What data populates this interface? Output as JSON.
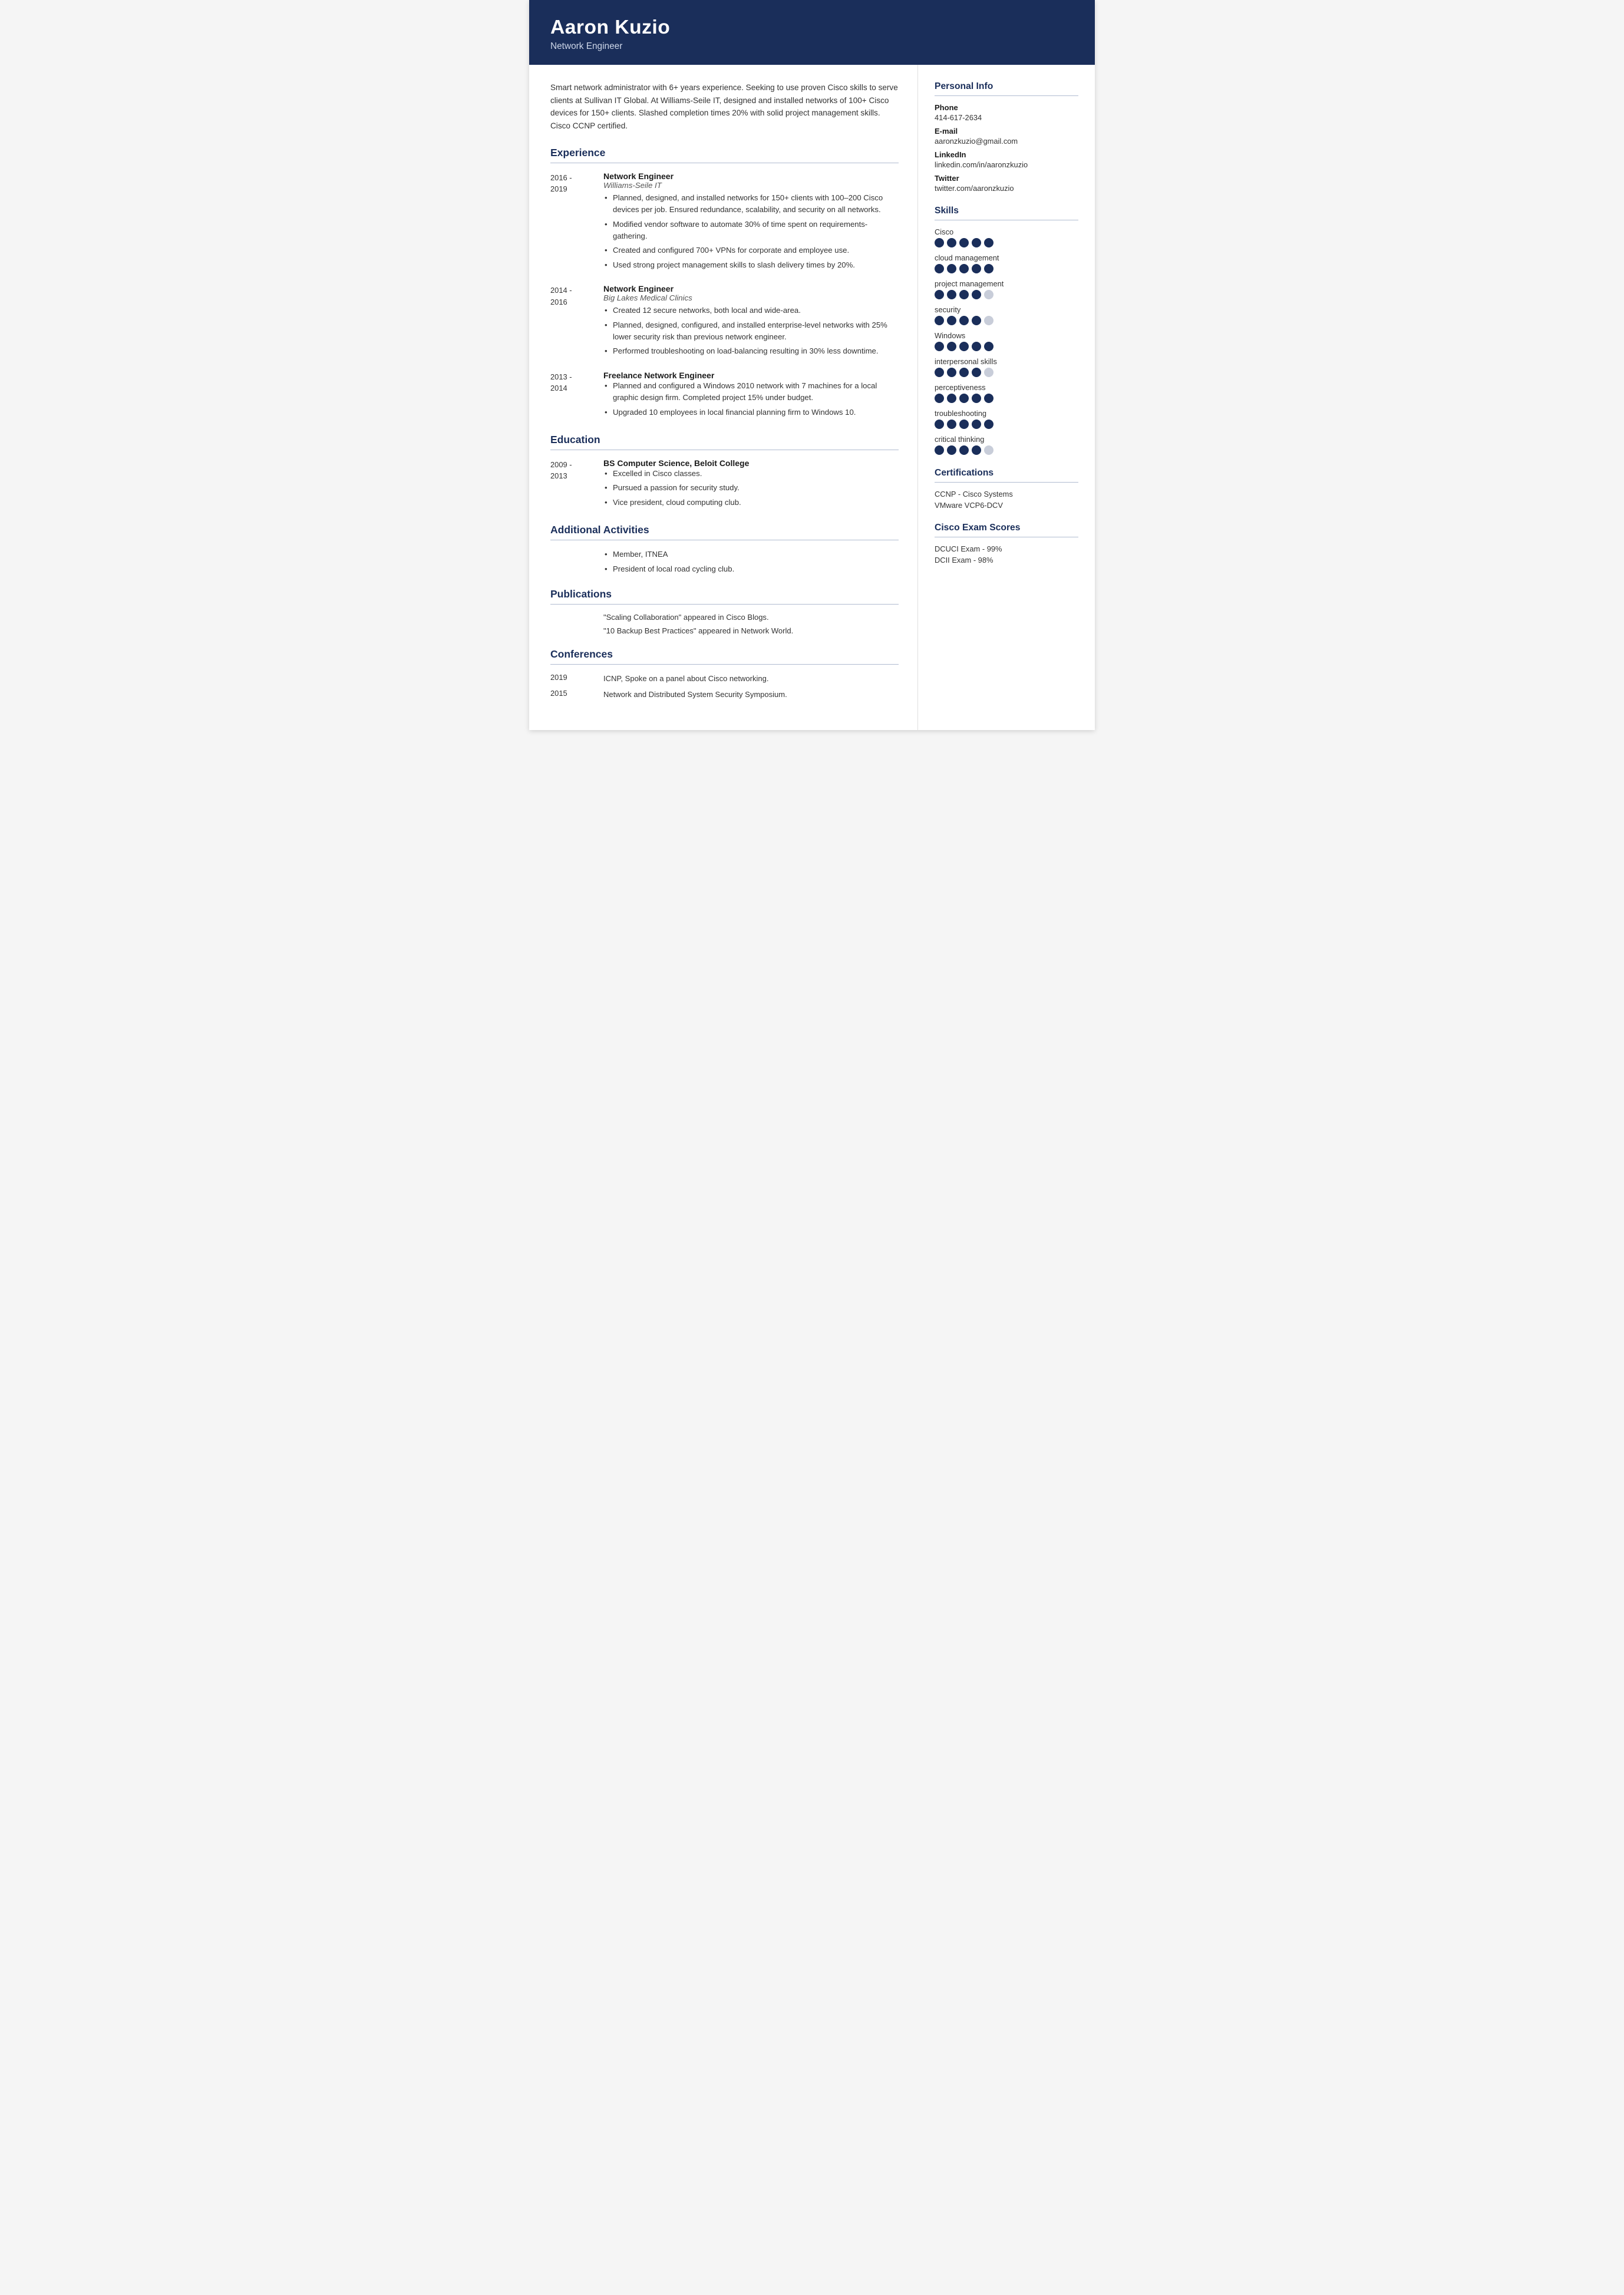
{
  "header": {
    "name": "Aaron Kuzio",
    "title": "Network Engineer"
  },
  "summary": "Smart network administrator with 6+ years experience. Seeking to use proven Cisco skills to serve clients at Sullivan IT Global. At Williams-Seile IT, designed and installed networks of 100+ Cisco devices for 150+ clients. Slashed completion times 20% with solid project management skills. Cisco CCNP certified.",
  "sections": {
    "experience_label": "Experience",
    "education_label": "Education",
    "additional_label": "Additional Activities",
    "publications_label": "Publications",
    "conferences_label": "Conferences"
  },
  "experience": [
    {
      "date_start": "2016 -",
      "date_end": "2019",
      "title": "Network Engineer",
      "org": "Williams-Seile IT",
      "bullets": [
        "Planned, designed, and installed networks for 150+ clients with 100–200 Cisco devices per job. Ensured redundance, scalability, and security on all networks.",
        "Modified vendor software to automate 30% of time spent on requirements-gathering.",
        "Created and configured 700+ VPNs for corporate and employee use.",
        "Used strong project management skills to slash delivery times by 20%."
      ]
    },
    {
      "date_start": "2014 -",
      "date_end": "2016",
      "title": "Network Engineer",
      "org": "Big Lakes Medical Clinics",
      "bullets": [
        "Created 12 secure networks, both local and wide-area.",
        "Planned, designed, configured, and installed enterprise-level networks with 25% lower security risk than previous network engineer.",
        "Performed troubleshooting on load-balancing resulting in 30% less downtime."
      ]
    },
    {
      "date_start": "2013 -",
      "date_end": "2014",
      "title": "Freelance Network Engineer",
      "org": "",
      "bullets": [
        "Planned and configured a Windows 2010 network with 7 machines for a local graphic design firm. Completed project 15% under budget.",
        "Upgraded 10 employees in local financial planning firm to Windows 10."
      ]
    }
  ],
  "education": [
    {
      "date_start": "2009 -",
      "date_end": "2013",
      "title": "BS Computer Science, Beloit College",
      "org": "",
      "bullets": [
        "Excelled in Cisco classes.",
        "Pursued a passion for security study.",
        "Vice president, cloud computing club."
      ]
    }
  ],
  "additional": {
    "bullets": [
      "Member, ITNEA",
      "President of local road cycling club."
    ]
  },
  "publications": {
    "items": [
      "\"Scaling Collaboration\" appeared in Cisco Blogs.",
      "\"10 Backup Best Practices\" appeared in Network World."
    ]
  },
  "conferences": [
    {
      "year": "2019",
      "desc": "ICNP, Spoke on a panel about Cisco networking."
    },
    {
      "year": "2015",
      "desc": "Network and Distributed System Security Symposium."
    }
  ],
  "personal_info": {
    "section_label": "Personal Info",
    "phone_label": "Phone",
    "phone": "414-617-2634",
    "email_label": "E-mail",
    "email": "aaronzkuzio@gmail.com",
    "linkedin_label": "LinkedIn",
    "linkedin": "linkedin.com/in/aaronzkuzio",
    "twitter_label": "Twitter",
    "twitter": "twitter.com/aaronzkuzio"
  },
  "skills": {
    "section_label": "Skills",
    "items": [
      {
        "name": "Cisco",
        "filled": 5,
        "total": 5
      },
      {
        "name": "cloud management",
        "filled": 5,
        "total": 5
      },
      {
        "name": "project management",
        "filled": 4,
        "total": 5
      },
      {
        "name": "security",
        "filled": 4,
        "total": 5
      },
      {
        "name": "Windows",
        "filled": 5,
        "total": 5
      },
      {
        "name": "interpersonal skills",
        "filled": 4,
        "total": 5
      },
      {
        "name": "perceptiveness",
        "filled": 5,
        "total": 5
      },
      {
        "name": "troubleshooting",
        "filled": 5,
        "total": 5
      },
      {
        "name": "critical thinking",
        "filled": 4,
        "total": 5
      }
    ]
  },
  "certifications": {
    "section_label": "Certifications",
    "items": [
      "CCNP - Cisco Systems",
      "VMware VCP6-DCV"
    ]
  },
  "cisco_scores": {
    "section_label": "Cisco Exam Scores",
    "items": [
      "DCUCI Exam - 99%",
      "DCII Exam - 98%"
    ]
  }
}
